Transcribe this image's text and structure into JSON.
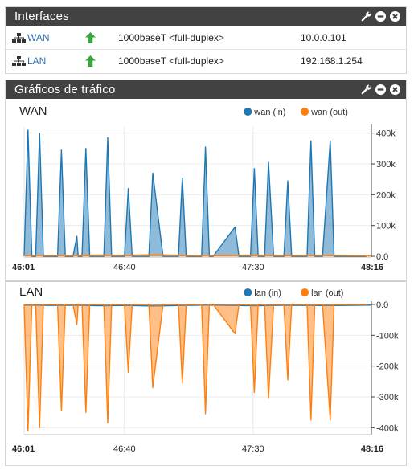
{
  "interfaces_panel": {
    "title": "Interfaces",
    "rows": [
      {
        "name": "WAN",
        "status": "up",
        "media": "1000baseT <full-duplex>",
        "ip": "10.0.0.101"
      },
      {
        "name": "LAN",
        "status": "up",
        "media": "1000baseT <full-duplex>",
        "ip": "192.168.1.254"
      }
    ]
  },
  "traffic_panel": {
    "title": "Gráficos de tráfico"
  },
  "colors": {
    "header_bg": "#424242",
    "in_series": "#1f77b4",
    "out_series": "#ff7f0e",
    "status_up": "#3aa53a",
    "link": "#2f6fb0"
  },
  "chart_data": [
    {
      "type": "area",
      "title": "WAN",
      "x_ticks": [
        "46:01",
        "46:40",
        "47:30",
        "48:16"
      ],
      "y_ticks": [
        "400k",
        "300k",
        "200k",
        "100k",
        "0.0"
      ],
      "ylim": [
        0,
        420000
      ],
      "xlim_seconds": [
        0,
        135
      ],
      "legend_position": "top-right",
      "grid": true,
      "series": [
        {
          "name": "wan (in)",
          "color": "#1f77b4",
          "x": [
            0,
            1.5,
            3,
            4.5,
            6,
            7.5,
            9,
            13,
            14.5,
            16,
            17.5,
            19,
            20.5,
            21,
            22,
            22.5,
            24,
            25.5,
            27,
            28.5,
            31,
            32.5,
            34,
            35.5,
            37,
            39,
            40.5,
            42,
            47,
            48.5,
            50,
            54,
            55.5,
            57,
            60,
            61.5,
            63,
            64,
            65.5,
            67,
            69,
            70.5,
            72,
            73.5,
            82,
            83.5,
            85,
            88,
            89.5,
            91,
            92,
            93.5,
            95,
            97,
            98.5,
            100,
            101,
            102.5,
            104,
            105,
            106.5,
            108,
            110,
            111.5,
            113,
            114.5,
            116,
            119,
            120.5,
            122,
            125,
            126.5,
            128,
            130,
            131.5,
            133
          ],
          "y": [
            0,
            410000,
            0,
            0,
            400000,
            0,
            0,
            0,
            345000,
            0,
            0,
            0,
            65000,
            0,
            0,
            0,
            350000,
            0,
            0,
            0,
            0,
            385000,
            0,
            0,
            0,
            0,
            220000,
            0,
            0,
            0,
            270000,
            0,
            0,
            0,
            0,
            255000,
            0,
            0,
            0,
            0,
            0,
            355000,
            0,
            0,
            95000,
            0,
            0,
            0,
            285000,
            0,
            0,
            0,
            305000,
            0,
            0,
            0,
            0,
            245000,
            0,
            0,
            0,
            0,
            0,
            375000,
            0,
            0,
            0,
            375000,
            0,
            0,
            0,
            0,
            0,
            0,
            0,
            0
          ]
        },
        {
          "name": "wan (out)",
          "color": "#ff7f0e",
          "x": [
            0,
            10,
            20,
            30,
            40,
            50,
            60,
            70,
            80,
            90,
            100,
            110,
            120,
            135
          ],
          "y": [
            2000,
            3000,
            2500,
            4000,
            3000,
            5000,
            3500,
            2000,
            3000,
            4000,
            2500,
            3000,
            3500,
            2000
          ]
        }
      ]
    },
    {
      "type": "area",
      "title": "LAN",
      "x_ticks": [
        "46:01",
        "46:40",
        "47:30",
        "48:16"
      ],
      "y_ticks": [
        "0.0",
        "-100k",
        "-200k",
        "-300k",
        "-400k"
      ],
      "ylim": [
        -420000,
        0
      ],
      "xlim_seconds": [
        0,
        135
      ],
      "legend_position": "top-right",
      "grid": true,
      "series": [
        {
          "name": "lan (in)",
          "color": "#1f77b4",
          "x": [
            0,
            10,
            20,
            30,
            40,
            50,
            60,
            70,
            80,
            90,
            100,
            110,
            120,
            135
          ],
          "y": [
            -2000,
            -3000,
            -2500,
            -4000,
            -3000,
            -5000,
            -3500,
            -2000,
            -3000,
            -4000,
            -2500,
            -3000,
            -3500,
            -2000
          ]
        },
        {
          "name": "lan (out)",
          "color": "#ff7f0e",
          "x": [
            0,
            1.5,
            3,
            4.5,
            6,
            7.5,
            9,
            13,
            14.5,
            16,
            17.5,
            19,
            20.5,
            21,
            22,
            22.5,
            24,
            25.5,
            27,
            28.5,
            31,
            32.5,
            34,
            35.5,
            37,
            39,
            40.5,
            42,
            47,
            48.5,
            50,
            54,
            55.5,
            57,
            60,
            61.5,
            63,
            64,
            65.5,
            67,
            69,
            70.5,
            72,
            73.5,
            82,
            83.5,
            85,
            88,
            89.5,
            91,
            92,
            93.5,
            95,
            97,
            98.5,
            100,
            101,
            102.5,
            104,
            105,
            106.5,
            108,
            110,
            111.5,
            113,
            114.5,
            116,
            119,
            120.5,
            122,
            125,
            126.5,
            128,
            130,
            131.5,
            133
          ],
          "y": [
            0,
            -410000,
            0,
            0,
            -400000,
            0,
            0,
            0,
            -345000,
            0,
            0,
            0,
            -65000,
            0,
            0,
            0,
            -350000,
            0,
            0,
            0,
            0,
            -385000,
            0,
            0,
            0,
            0,
            -220000,
            0,
            0,
            0,
            -270000,
            0,
            0,
            0,
            0,
            -255000,
            0,
            0,
            0,
            0,
            0,
            -355000,
            0,
            0,
            -95000,
            0,
            0,
            0,
            -285000,
            0,
            0,
            0,
            -305000,
            0,
            0,
            0,
            0,
            -245000,
            0,
            0,
            0,
            0,
            0,
            -375000,
            0,
            0,
            0,
            -375000,
            0,
            0,
            0,
            0,
            0,
            0,
            0,
            0
          ]
        }
      ]
    }
  ]
}
